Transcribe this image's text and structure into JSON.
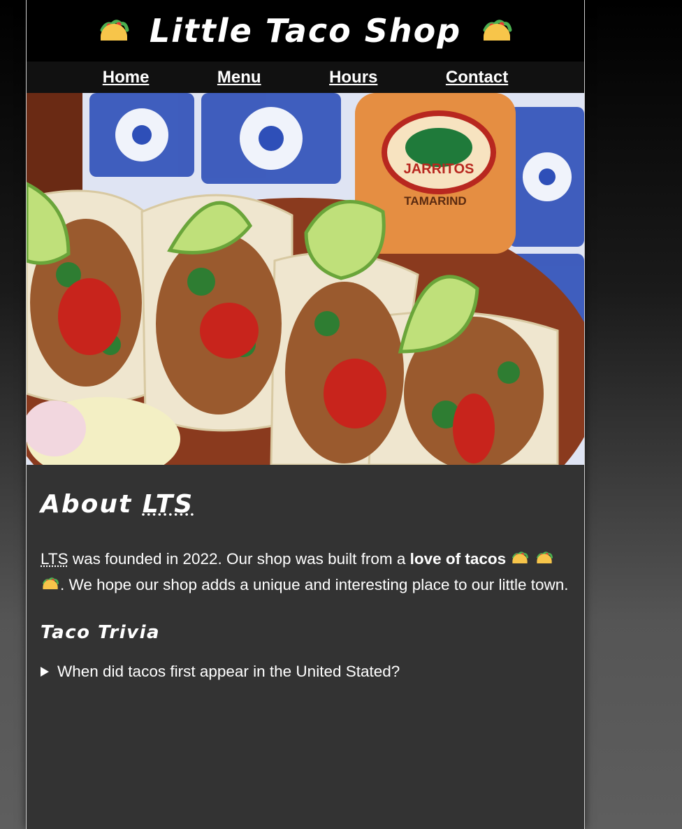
{
  "header": {
    "title": "Little Taco Shop",
    "title_icon": "taco-icon"
  },
  "nav": {
    "items": [
      "Home",
      "Menu",
      "Hours",
      "Contact"
    ]
  },
  "hero": {
    "description": "tacos-with-limes-and-salsa-photo",
    "bottle_label": "JARRITOS",
    "bottle_flavor": "TAMARIND"
  },
  "about": {
    "heading_prefix": "About",
    "heading_abbr": "LTS",
    "intro_abbr": "LTS",
    "intro_text_1": " was founded in 2022. Our shop was built from a ",
    "intro_bold": "love of tacos",
    "intro_text_2": ". We hope our shop adds a unique and interesting place to our little town."
  },
  "trivia": {
    "heading": "Taco Trivia",
    "question": "When did tacos first appear in the United Stated?"
  },
  "colors": {
    "page_bg": "#333333",
    "banner_bg": "#000000",
    "nav_bg": "#111111",
    "text": "#ffffff"
  }
}
